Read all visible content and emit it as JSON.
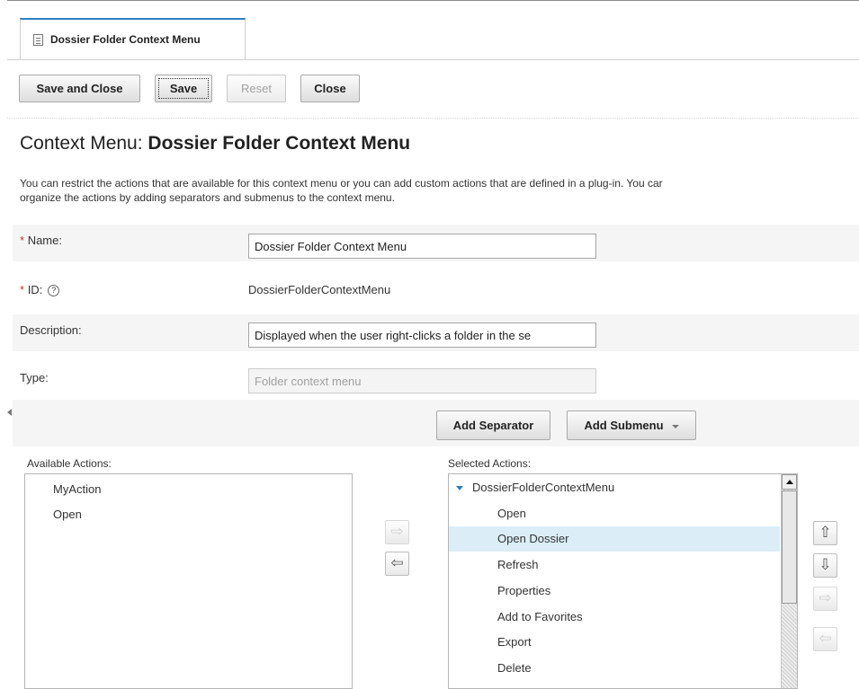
{
  "tab": {
    "label": "Dossier Folder Context Menu"
  },
  "toolbar": {
    "save_close": "Save and Close",
    "save": "Save",
    "reset": "Reset",
    "close": "Close"
  },
  "page": {
    "title_prefix": "Context Menu: ",
    "title_name": "Dossier Folder Context Menu",
    "intro_line1": "You can restrict the actions that are available for this context menu or you can add custom actions that are defined in a plug-in. You car",
    "intro_line2": "organize the actions by adding separators and submenus to the context menu."
  },
  "form": {
    "required_mark": "*",
    "name_label": "Name:",
    "name_value": "Dossier Folder Context Menu",
    "id_label": "ID:",
    "id_help": "?",
    "id_value": "DossierFolderContextMenu",
    "description_label": "Description:",
    "description_value": "Displayed when the user right-clicks a folder in the se",
    "type_label": "Type:",
    "type_value": "Folder context menu"
  },
  "actions": {
    "add_separator": "Add Separator",
    "add_submenu": "Add Submenu",
    "available_label": "Available Actions:",
    "available_items": [
      "MyAction",
      "Open"
    ],
    "selected_label": "Selected Actions:",
    "selected_root": "DossierFolderContextMenu",
    "selected_items": [
      "Open",
      "Open Dossier",
      "Refresh",
      "Properties",
      "Add to Favorites",
      "Export",
      "Delete"
    ],
    "selected_highlight": "Open Dossier"
  },
  "move_buttons": {
    "add_right": "⇨",
    "remove_left": "⇦",
    "move_up": "⇧",
    "move_down": "⇩",
    "submenu_in": "⇨",
    "submenu_out": "⇦"
  },
  "colors": {
    "accent": "#2f7fc0",
    "selected_row": "#dbeef8",
    "required": "#c0392b"
  }
}
